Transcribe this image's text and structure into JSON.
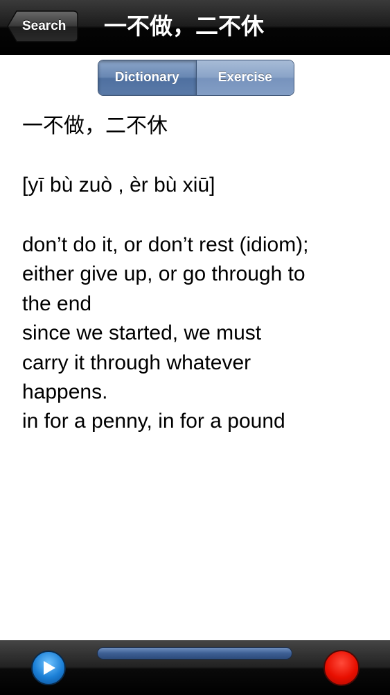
{
  "navbar": {
    "back_label": "Search",
    "title": "一不做，二不休"
  },
  "tabs": [
    {
      "label": "Dictionary",
      "selected": true
    },
    {
      "label": "Exercise",
      "selected": false
    }
  ],
  "entry": {
    "headword": "一不做，二不休",
    "pinyin": "[yī bù zuò , èr bù xiū]",
    "definition_lines": [
      "don’t do it, or don’t rest (idiom);",
      "either give up, or go through to",
      "the end",
      "since we started, we must",
      "carry it through whatever",
      "happens.",
      "in for a penny, in for a pound"
    ]
  },
  "toolbar": {
    "play_icon": "play-icon",
    "record_icon": "record-icon",
    "play_color": "#1b7fd6",
    "record_color": "#e80f00"
  }
}
